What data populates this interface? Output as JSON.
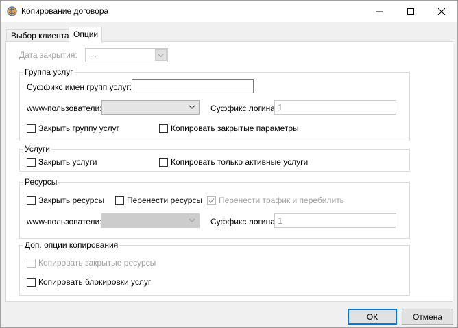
{
  "window": {
    "title": "Копирование договора"
  },
  "tabs": [
    {
      "label": "Выбор клиента"
    },
    {
      "label": "Опции"
    }
  ],
  "close_date": {
    "label": "Дата закрытия:",
    "value": " .  ."
  },
  "service_group": {
    "title": "Группа услуг",
    "suffix_label": "Суффикс имен групп услуг:",
    "suffix_value": "",
    "www_users_label": "www-пользователи:",
    "www_users_value": "",
    "login_suffix_label": "Суффикс логина:",
    "login_suffix_value": "1",
    "close_group_label": "Закрыть группу услуг",
    "copy_closed_params_label": "Копировать закрытые параметры"
  },
  "services": {
    "title": "Услуги",
    "close_services_label": "Закрыть услуги",
    "copy_active_only_label": "Копировать только активные услуги"
  },
  "resources": {
    "title": "Ресурсы",
    "close_resources_label": "Закрыть ресурсы",
    "move_resources_label": "Перенести ресурсы",
    "move_traffic_label": "Перенести трафик и перебилить",
    "www_users_label": "www-пользователи:",
    "www_users_value": "",
    "login_suffix_label": "Суффикс логина:",
    "login_suffix_value": "1"
  },
  "extra": {
    "title": "Доп. опции копирования",
    "copy_closed_resources_label": "Копировать закрытые ресурсы",
    "copy_service_locks_label": "Копировать блокировки услуг"
  },
  "footer": {
    "ok_label": "ОК",
    "cancel_label": "Отмена"
  },
  "colors": {
    "accent": "#0078d7",
    "disabled_text": "#a0a0a0",
    "panel_bg": "#ffffff",
    "window_bg": "#f0f0f0"
  }
}
